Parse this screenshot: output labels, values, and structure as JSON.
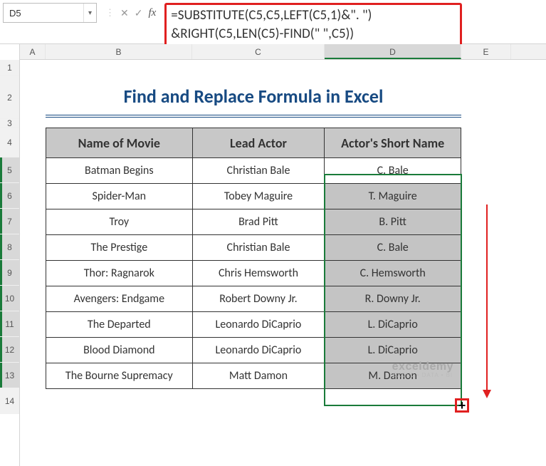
{
  "nameBox": {
    "cellRef": "D5"
  },
  "formulaBar": {
    "fxLabel": "fx",
    "formulaLine1": "=SUBSTITUTE(C5,C5,LEFT(C5,1)&\". \")",
    "formulaLine2": "&RIGHT(C5,LEN(C5)-FIND(\" \",C5))"
  },
  "columns": {
    "A": "A",
    "B": "B",
    "C": "C",
    "D": "D",
    "E": "E"
  },
  "rows": [
    "1",
    "2",
    "3",
    "4",
    "5",
    "6",
    "7",
    "8",
    "9",
    "10",
    "11",
    "12",
    "13",
    "14"
  ],
  "title": "Find and Replace Formula in Excel",
  "headers": {
    "B": "Name of Movie",
    "C": "Lead Actor",
    "D": "Actor's Short Name"
  },
  "data": [
    {
      "movie": "Batman Begins",
      "actor": "Christian Bale",
      "short": "C. Bale"
    },
    {
      "movie": "Spider-Man",
      "actor": "Tobey Maguire",
      "short": "T. Maguire"
    },
    {
      "movie": "Troy",
      "actor": "Brad Pitt",
      "short": "B. Pitt"
    },
    {
      "movie": "The Prestige",
      "actor": "Christian Bale",
      "short": "C. Bale"
    },
    {
      "movie": "Thor: Ragnarok",
      "actor": "Chris Hemsworth",
      "short": "C. Hemsworth"
    },
    {
      "movie": "Avengers: Endgame",
      "actor": "Robert Downy Jr.",
      "short": "R. Downy Jr."
    },
    {
      "movie": "The Departed",
      "actor": "Leonardo DiCaprio",
      "short": "L. DiCaprio"
    },
    {
      "movie": "Blood Diamond",
      "actor": "Leonardo DiCaprio",
      "short": "L. DiCaprio"
    },
    {
      "movie": "The Bourne Supremacy",
      "actor": "Matt Damon",
      "short": "M. Damon"
    }
  ],
  "watermark": {
    "line1": "exceldemy",
    "line2": "EXCEL • DATA • BI"
  },
  "icons": {
    "dropdown": "▾",
    "cancel": "✕",
    "confirm": "✓",
    "separator": "⋮",
    "plus": "+"
  }
}
